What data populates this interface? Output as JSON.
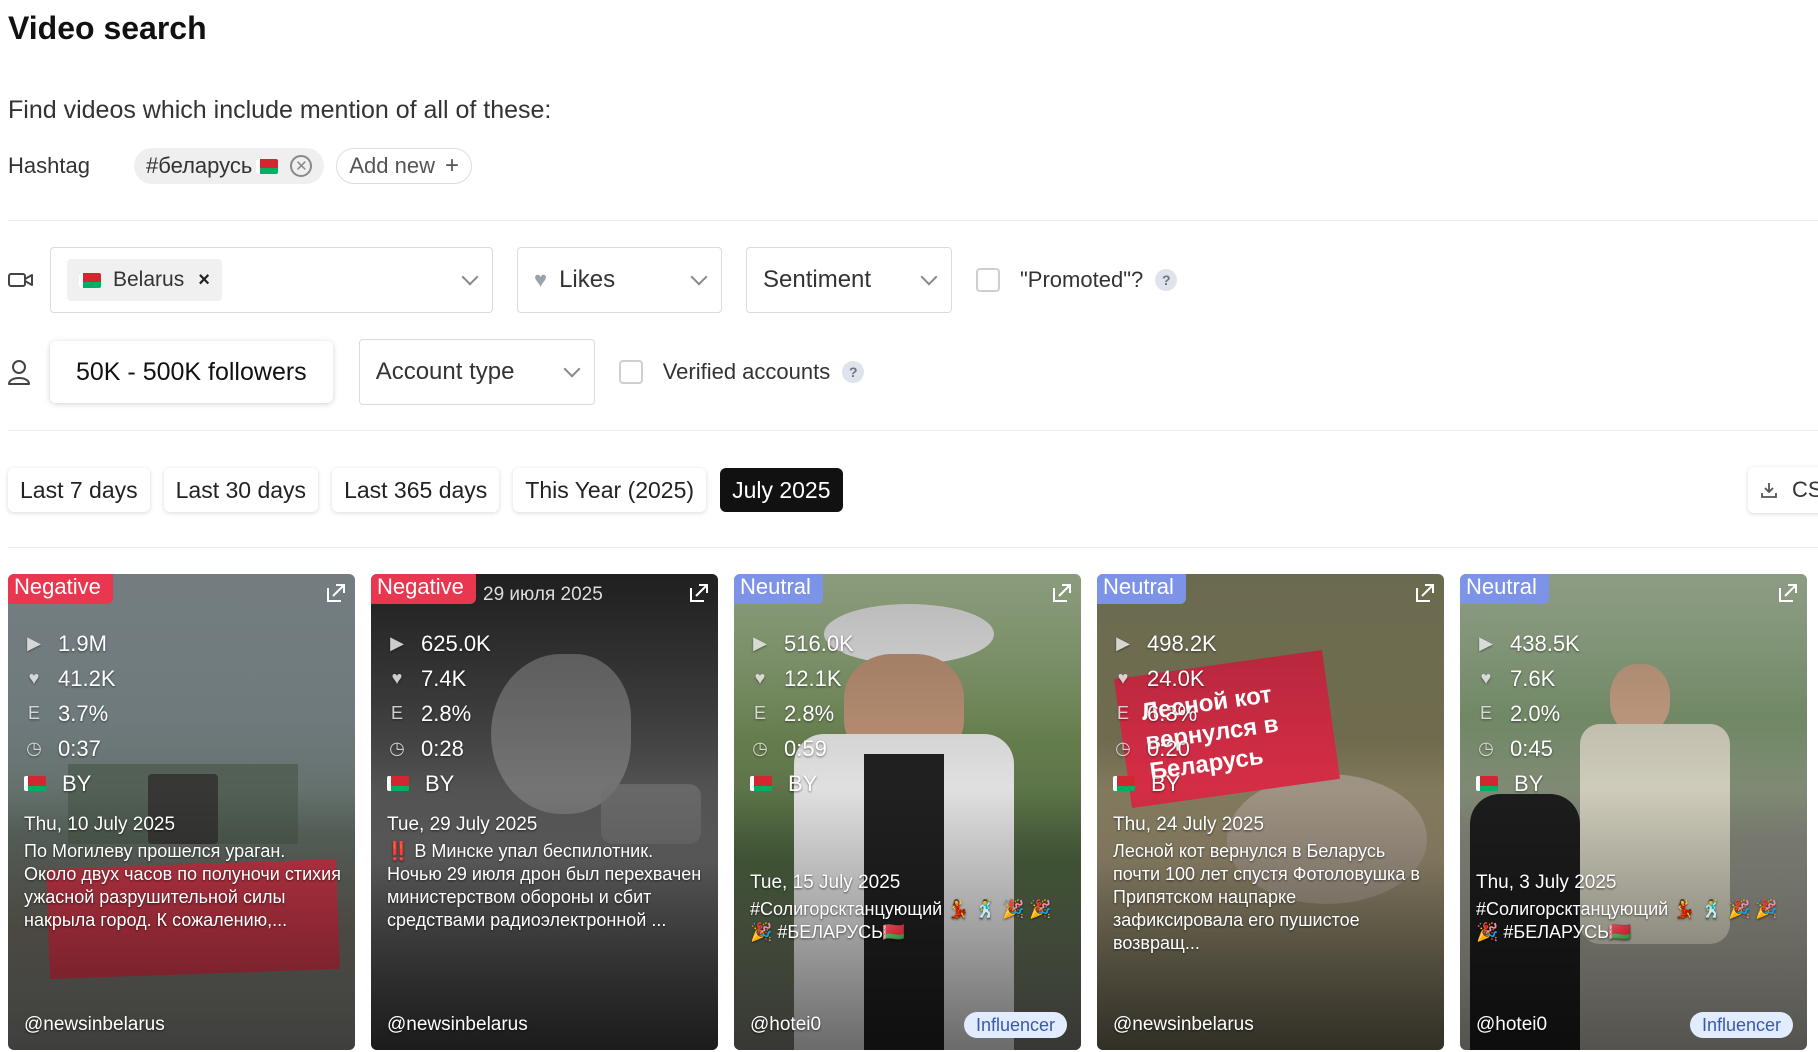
{
  "header": {
    "title": "Video search",
    "subtitle": "Find videos which include mention of all of these:"
  },
  "hashtags": {
    "label": "Hashtag",
    "items": [
      {
        "text": "#беларусь"
      }
    ],
    "add_label": "Add new"
  },
  "filters": {
    "country": "Belarus",
    "likes": "Likes",
    "sentiment": "Sentiment",
    "promoted": "\"Promoted\"?",
    "followers": "50K - 500K followers",
    "account_type": "Account type",
    "verified": "Verified accounts",
    "help": "?"
  },
  "periods": [
    {
      "label": "Last 7 days",
      "active": false
    },
    {
      "label": "Last 30 days",
      "active": false
    },
    {
      "label": "Last 365 days",
      "active": false
    },
    {
      "label": "This Year (2025)",
      "active": false
    },
    {
      "label": "July 2025",
      "active": true
    }
  ],
  "export_label": "CS",
  "colors": {
    "negative": "#e8374f",
    "neutral": "#7d93e8",
    "active_period": "#111111",
    "influencer_bg": "#e2ecff"
  },
  "cards": [
    {
      "sentiment": "Negative",
      "views": "1.9M",
      "likes": "41.2K",
      "engagement": "3.7%",
      "duration": "0:37",
      "country": "BY",
      "date": "Thu, 10 July 2025",
      "text": "По Могилеву прошелся ураган. Около двух часов по полуночи стихия ужасной разрушительной силы накрыла город. К сожалению,...",
      "handle": "@newsinbelarus",
      "influencer": ""
    },
    {
      "sentiment": "Negative",
      "views": "625.0K",
      "likes": "7.4K",
      "engagement": "2.8%",
      "duration": "0:28",
      "country": "BY",
      "date": "Tue, 29 July 2025",
      "text": "‼️ В Минске упал беспилотник. Ночью 29 июля дрон был перехвачен министерством обороны и сбит средствами радиоэлектронной ...",
      "handle": "@newsinbelarus",
      "influencer": "",
      "overlay": "29 июля 2025"
    },
    {
      "sentiment": "Neutral",
      "views": "516.0K",
      "likes": "12.1K",
      "engagement": "2.8%",
      "duration": "0:59",
      "country": "BY",
      "date": "Tue, 15 July 2025",
      "text": "#Солигорсктанцующий 💃 🕺 🎉 🎉 🎉 #БЕЛАРУСЬ🇧🇾",
      "handle": "@hotei0",
      "influencer": "Influencer"
    },
    {
      "sentiment": "Neutral",
      "views": "498.2K",
      "likes": "24.0K",
      "engagement": "6.3%",
      "duration": "0:20",
      "country": "BY",
      "date": "Thu, 24 July 2025",
      "text": "Лесной кот вернулся в Беларусь почти 100 лет спустя Фотоловушка в Припятском нацпарке зафиксировала его пушистое возвращ...",
      "handle": "@newsinbelarus",
      "influencer": "",
      "overlay": "Лесной кот вернулся в Беларусь"
    },
    {
      "sentiment": "Neutral",
      "views": "438.5K",
      "likes": "7.6K",
      "engagement": "2.0%",
      "duration": "0:45",
      "country": "BY",
      "date": "Thu, 3 July 2025",
      "text": "#Солигорсктанцующий 💃 🕺 🎉 🎉 🎉 #БЕЛАРУСЬ🇧🇾",
      "handle": "@hotei0",
      "influencer": "Influencer"
    }
  ]
}
